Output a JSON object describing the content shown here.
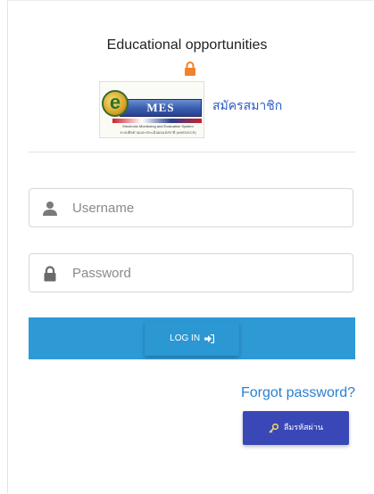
{
  "header": {
    "title": "Educational opportunities",
    "lock_icon": "lock-icon",
    "lock_color": "#f0822a"
  },
  "logo": {
    "letter": "e",
    "banner_text": "MES",
    "subtitle_line1": "Electronic Monitoring and Evaluation System",
    "subtitle_line2": "ระบบติดตามและประเมินผลแห่งชาติ (eMENSCR)",
    "register_label": "สมัครสมาชิก"
  },
  "form": {
    "username": {
      "value": "",
      "placeholder": "Username",
      "icon": "user-icon"
    },
    "password": {
      "value": "",
      "placeholder": "Password",
      "icon": "lock-icon"
    },
    "login_label": "LOG IN",
    "login_icon": "sign-in-icon"
  },
  "footer": {
    "forgot_label": "Forgot password?",
    "reset_label": "ลืมรหัสผ่าน",
    "reset_icon": "key-icon"
  },
  "colors": {
    "accent": "#2d9ad6",
    "link": "#2a7fd0",
    "reset_button": "#3a47b6",
    "lock": "#f0822a"
  }
}
